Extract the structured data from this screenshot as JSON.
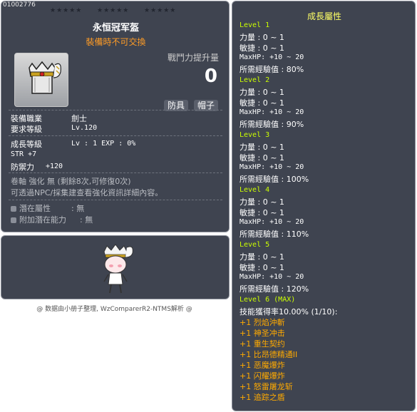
{
  "item": {
    "id": "01002776",
    "stars": [
      "★★★★★",
      "★★★★★",
      "★★★★★"
    ],
    "name": "永恒冠军盔",
    "notice": "裝備時不可交換",
    "combat_label": "戰鬥力提升量",
    "combat_value": "0",
    "tags": [
      "防具",
      "帽子"
    ],
    "job_label": "裝備職業",
    "job_value": "劍士",
    "req_level_label": "要求等級",
    "req_level_value": "Lv.120",
    "growth_label": "成長等級",
    "growth_value": "Lv : 1   EXP : 0%",
    "stat_str": "STR  +7",
    "defense_label": "防禦力",
    "defense_value": "+120",
    "scroll_line": "卷軸 強化 無 (剩餘8次,可修復0次)",
    "npc_line": "可透過NPC/採集建查看強化資訊詳細內容。",
    "potential_label": "潛在屬性",
    "potential_value": ": 無",
    "bonus_potential_label": "附加潛在能力",
    "bonus_potential_value": ": 無",
    "footer": "@ 数据由小册子整理, WzComparerR2-NTMS解析 @"
  },
  "growth": {
    "title": "成長屬性",
    "levels": [
      {
        "label": "Level 1",
        "str": "力量 : 0 ~ 1",
        "dex": "敏捷 : 0 ~ 1",
        "hp": "MaxHP: +10 ~ 20",
        "exp": "所需經驗值 : 80%"
      },
      {
        "label": "Level 2",
        "str": "力量 : 0 ~ 1",
        "dex": "敏捷 : 0 ~ 1",
        "hp": "MaxHP: +10 ~ 20",
        "exp": "所需經驗值 : 90%"
      },
      {
        "label": "Level 3",
        "str": "力量 : 0 ~ 1",
        "dex": "敏捷 : 0 ~ 1",
        "hp": "MaxHP: +10 ~ 20",
        "exp": "所需經驗值 : 100%"
      },
      {
        "label": "Level 4",
        "str": "力量 : 0 ~ 1",
        "dex": "敏捷 : 0 ~ 1",
        "hp": "MaxHP: +10 ~ 20",
        "exp": "所需經驗值 : 110%"
      },
      {
        "label": "Level 5",
        "str": "力量 : 0 ~ 1",
        "dex": "敏捷 : 0 ~ 1",
        "hp": "MaxHP: +10 ~ 20",
        "exp": "所需經驗值 : 120%"
      }
    ],
    "max_label": "Level 6 (MAX)",
    "skill_rate": "技能獲得率10.00% (1/10):",
    "skills": [
      "+1 烈焰沖斬",
      "+1 神圣冲击",
      "+1 重生契约",
      "+1 比昂德精通II",
      "+1 恶魔爆炸",
      "+1 闪耀爆炸",
      "+1 怒雷屠龙斩",
      "+1 追踪之盾"
    ]
  }
}
